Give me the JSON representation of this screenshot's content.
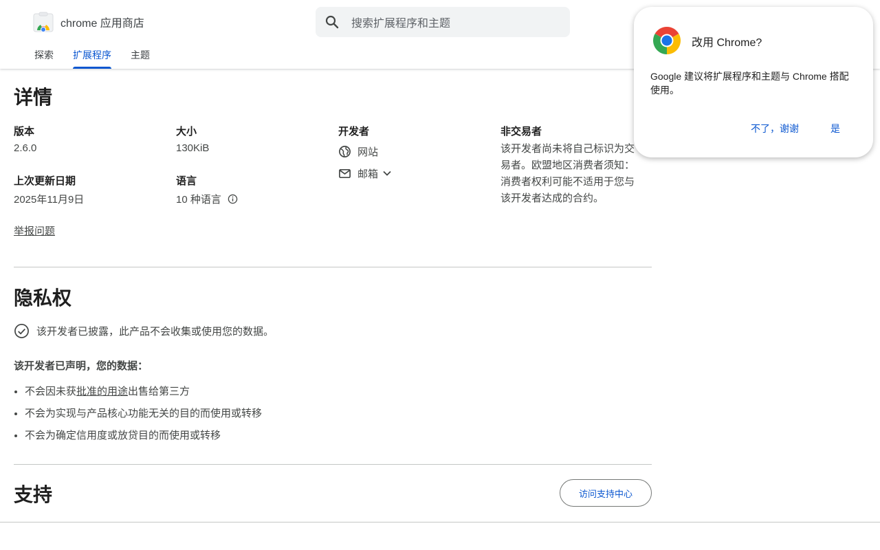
{
  "header": {
    "store_name": "chrome 应用商店",
    "search_placeholder": "搜索扩展程序和主题",
    "tabs": [
      {
        "label": "探索",
        "active": false
      },
      {
        "label": "扩展程序",
        "active": true
      },
      {
        "label": "主题",
        "active": false
      }
    ]
  },
  "details": {
    "title": "详情",
    "version": {
      "label": "版本",
      "value": "2.6.0"
    },
    "size": {
      "label": "大小",
      "value": "130KiB"
    },
    "developer": {
      "label": "开发者",
      "website": "网站",
      "email": "邮箱"
    },
    "trader": {
      "label": "非交易者",
      "text": "该开发者尚未将自己标识为交易者。欧盟地区消费者须知：消费者权利可能不适用于您与该开发者达成的合约。"
    },
    "updated": {
      "label": "上次更新日期",
      "value": "2025年11月9日"
    },
    "language": {
      "label": "语言",
      "value": "10 种语言"
    },
    "report": "举报问题"
  },
  "privacy": {
    "title": "隐私权",
    "disclosure": "该开发者已披露，此产品不会收集或使用您的数据。",
    "declared": "该开发者已声明，您的数据：",
    "bullets": {
      "b1_prefix": "不会因未获",
      "b1_link": "批准的用途",
      "b1_suffix": "出售给第三方",
      "b2": "不会为实现与产品核心功能无关的目的而使用或转移",
      "b3": "不会为确定信用度或放贷目的而使用或转移"
    }
  },
  "support": {
    "title": "支持",
    "button": "访问支持中心"
  },
  "popup": {
    "title": "改用 Chrome?",
    "body": "Google 建议将扩展程序和主题与 Chrome 搭配使用。",
    "no_button": "不了，谢谢",
    "yes_button": "是"
  },
  "colors": {
    "accent": "#0b57d0",
    "text_primary": "#1f1f1f",
    "text_secondary": "#444746",
    "divider": "#c4c7c5"
  }
}
